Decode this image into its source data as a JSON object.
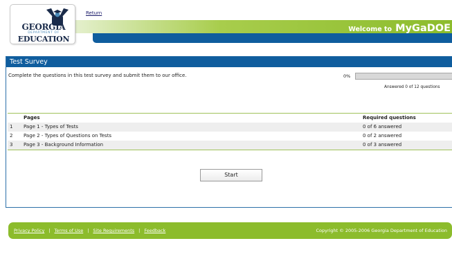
{
  "header": {
    "logo": {
      "line1": "GEORGIA",
      "line2": "DEPARTMENT OF",
      "line3": "EDUCATION"
    },
    "return_link": "Return",
    "welcome_prefix": "Welcome to",
    "welcome_brand": "MyGaDOE"
  },
  "survey": {
    "title": "Test Survey",
    "intro": "Complete the questions in this test survey and submit them to our office.",
    "progress_text": "0%",
    "progress_value": 0,
    "answered_summary": "Answered 0 of 12 questions",
    "columns": {
      "pages": "Pages",
      "required": "Required questions"
    },
    "rows": [
      {
        "num": "1",
        "page": "Page 1 - Types of Tests",
        "required": "0 of 6 answered"
      },
      {
        "num": "2",
        "page": "Page 2 - Types of Questions on Tests",
        "required": "0 of 2 answered"
      },
      {
        "num": "3",
        "page": "Page 3 - Background Information",
        "required": "0 of 3 answered"
      }
    ],
    "start_label": "Start"
  },
  "footer": {
    "links": [
      "Privacy Policy",
      "Terms of Use",
      "Site Requirements",
      "Feedback"
    ],
    "copyright": "Copyright © 2005-2006 Georgia Department of Education"
  },
  "colors": {
    "brand_blue": "#0f5d9e",
    "brand_green": "#8cbc2c",
    "logo_navy": "#1a2b4a"
  },
  "icons": {
    "logo_figure": "graduate-figure-icon"
  }
}
